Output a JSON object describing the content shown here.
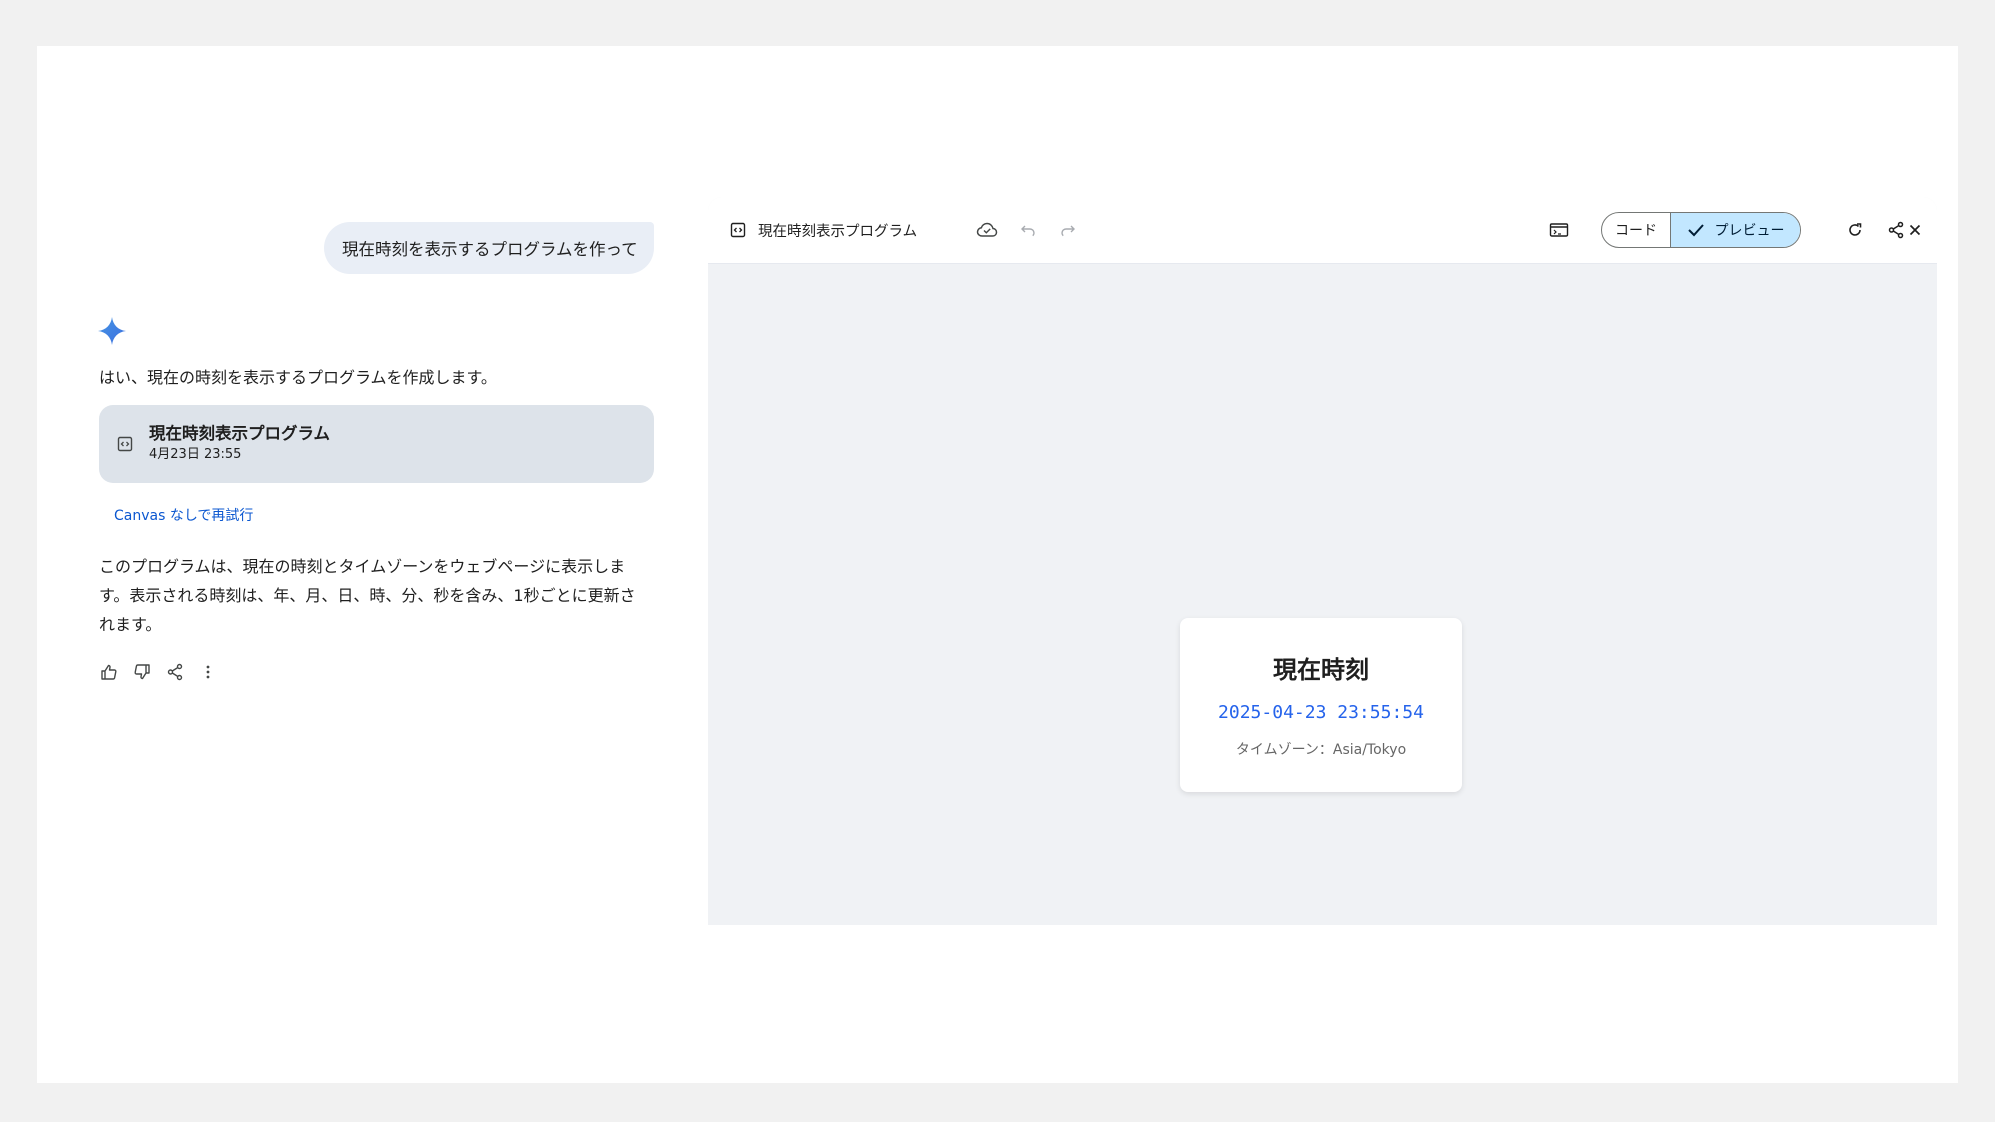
{
  "chat": {
    "user_prompt": "現在時刻を表示するプログラムを作って",
    "reply_intro": "はい、現在の時刻を表示するプログラムを作成します。",
    "doc_card": {
      "title": "現在時刻表示プログラム",
      "date": "4月23日 23:55"
    },
    "retry_link": "Canvas なしで再試行",
    "reply_body_lines": [
      "このプログラムは、現在の時刻とタイムゾーンをウェブページに表示しま",
      "す。表示される時刻は、年、月、日、時、分、秒を含み、1秒ごとに更新さ",
      "れます。"
    ],
    "feedback_icons": [
      "thumbs-up-icon",
      "thumbs-down-icon",
      "share-icon",
      "more-vert-icon"
    ]
  },
  "canvas": {
    "title": "現在時刻表示プログラム",
    "toolbar_icons": [
      "code-doc-icon",
      "cloud-save-icon",
      "undo-icon",
      "redo-icon",
      "console-icon",
      "refresh-icon",
      "share-icon",
      "close-icon"
    ],
    "mode_code_label": "コード",
    "mode_preview_label": "プレビュー",
    "active_mode": "preview",
    "preview": {
      "heading": "現在時刻",
      "time": "2025-04-23 23:55:54",
      "timezone": "タイムゾーン：Asia/Tokyo"
    }
  },
  "colors": {
    "accent_blue": "#0b57d0",
    "preview_time_blue": "#2563eb",
    "active_segment": "#c2e7ff",
    "canvas_bg": "#f0f2f5",
    "user_bubble": "#e9eef6",
    "doc_card": "#dde3ea"
  }
}
